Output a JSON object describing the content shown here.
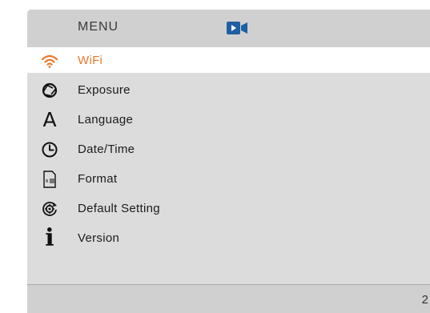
{
  "header": {
    "title": "MENU",
    "mode_icon": "video-camera-icon"
  },
  "colors": {
    "selected": "#e8782e",
    "panel": "#dcdcdc",
    "bar": "#d0d0d0"
  },
  "menu": {
    "items": [
      {
        "label": "WiFi",
        "icon": "wifi-icon",
        "selected": true
      },
      {
        "label": "Exposure",
        "icon": "aperture-icon",
        "selected": false
      },
      {
        "label": "Language",
        "icon": "letter-a-icon",
        "selected": false
      },
      {
        "label": "Date/Time",
        "icon": "clock-icon",
        "selected": false
      },
      {
        "label": "Format",
        "icon": "sd-card-icon",
        "selected": false
      },
      {
        "label": "Default Setting",
        "icon": "reset-gear-icon",
        "selected": false
      },
      {
        "label": "Version",
        "icon": "info-icon",
        "selected": false
      }
    ]
  },
  "footer": {
    "page": "2"
  }
}
